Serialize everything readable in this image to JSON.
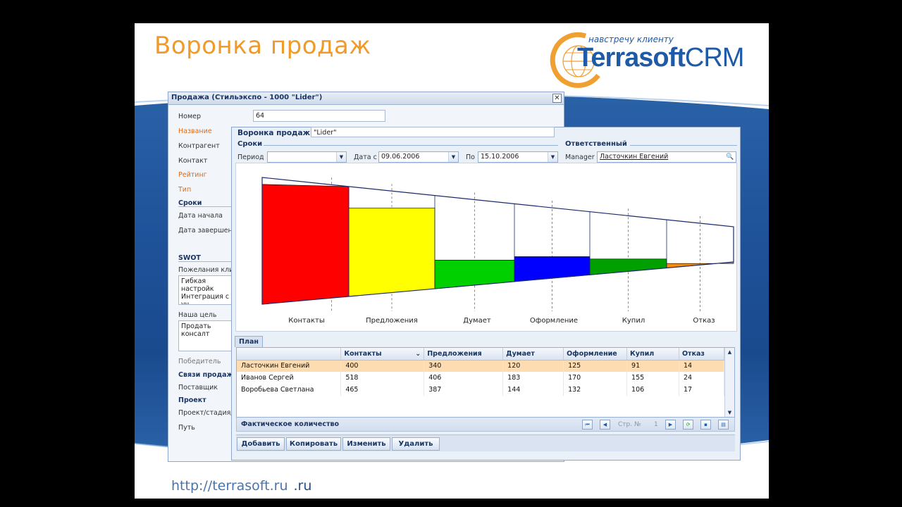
{
  "slide": {
    "title": "Воронка продаж",
    "logo_tagline": "навстречу клиенту",
    "logo_name": "Terrasoft",
    "logo_crm": "CRM",
    "footer_url": "http://terrasoft.ru",
    "footer_url_tld2": ".ru",
    "colors": {
      "title": "#f09a2a",
      "brand": "#1f5aa6",
      "band": "#1e5299"
    }
  },
  "back_window": {
    "title": "Продажа (Стильэкспо - 1000 \"Lider\")",
    "fields": {
      "number_label": "Номер",
      "number_value": "64",
      "name_label": "Название",
      "name_value": "\"Lider\"",
      "contractor_label": "Контрагент",
      "contact_label": "Контакт",
      "rating_label": "Рейтинг",
      "type_label": "Тип",
      "terms_header": "Сроки",
      "start_label": "Дата начала",
      "end_label": "Дата завершения",
      "swot_header": "SWOT",
      "wishes_label": "Пожелания клиен",
      "wishes_text_1": "Гибкая настройк",
      "wishes_text_2": "Интеграция с уч",
      "goal_label": "Наша цель",
      "goal_text": "Продать консалт",
      "winner_label": "Победитель",
      "links_header": "Связи продаж",
      "supplier_label": "Поставщик",
      "project_header": "Проект",
      "project_stage_label": "Проект/стадия/р",
      "path_label": "Путь"
    }
  },
  "front_window": {
    "title": "Воронка продаж",
    "terms_group": "Сроки",
    "responsible_group": "Ответственный",
    "period_label": "Период",
    "period_value": "",
    "date_from_label": "Дата с",
    "date_from_value": "09.06.2006",
    "date_to_label": "По",
    "date_to_value": "15.10.2006",
    "manager_label": "Manager",
    "manager_value": "Ласточкин Евгений",
    "plan_tab": "План",
    "fact_label": "Фактическое количество",
    "page_label": "Стр. №",
    "page_number": "1",
    "buttons": {
      "add": "Добавить",
      "copy": "Копировать",
      "edit": "Изменить",
      "delete": "Удалить"
    }
  },
  "table": {
    "columns": [
      "",
      "Контакты",
      "Предложения",
      "Думает",
      "Оформление",
      "Купил",
      "Отказ"
    ],
    "rows": [
      [
        "Ласточкин Евгений",
        "400",
        "340",
        "120",
        "125",
        "91",
        "14"
      ],
      [
        "Иванов Сергей",
        "518",
        "406",
        "183",
        "170",
        "155",
        "24"
      ],
      [
        "Воробьева Светлана",
        "465",
        "387",
        "144",
        "132",
        "106",
        "17"
      ]
    ]
  },
  "chart_data": {
    "type": "bar",
    "categories": [
      "Контакты",
      "Предложения",
      "Думает",
      "Оформление",
      "Купил",
      "Отказ"
    ],
    "values": [
      400,
      340,
      120,
      125,
      91,
      14
    ],
    "colors": [
      "#ff0000",
      "#ffff00",
      "#00d000",
      "#0000ff",
      "#00a000",
      "#ff8c00"
    ]
  }
}
